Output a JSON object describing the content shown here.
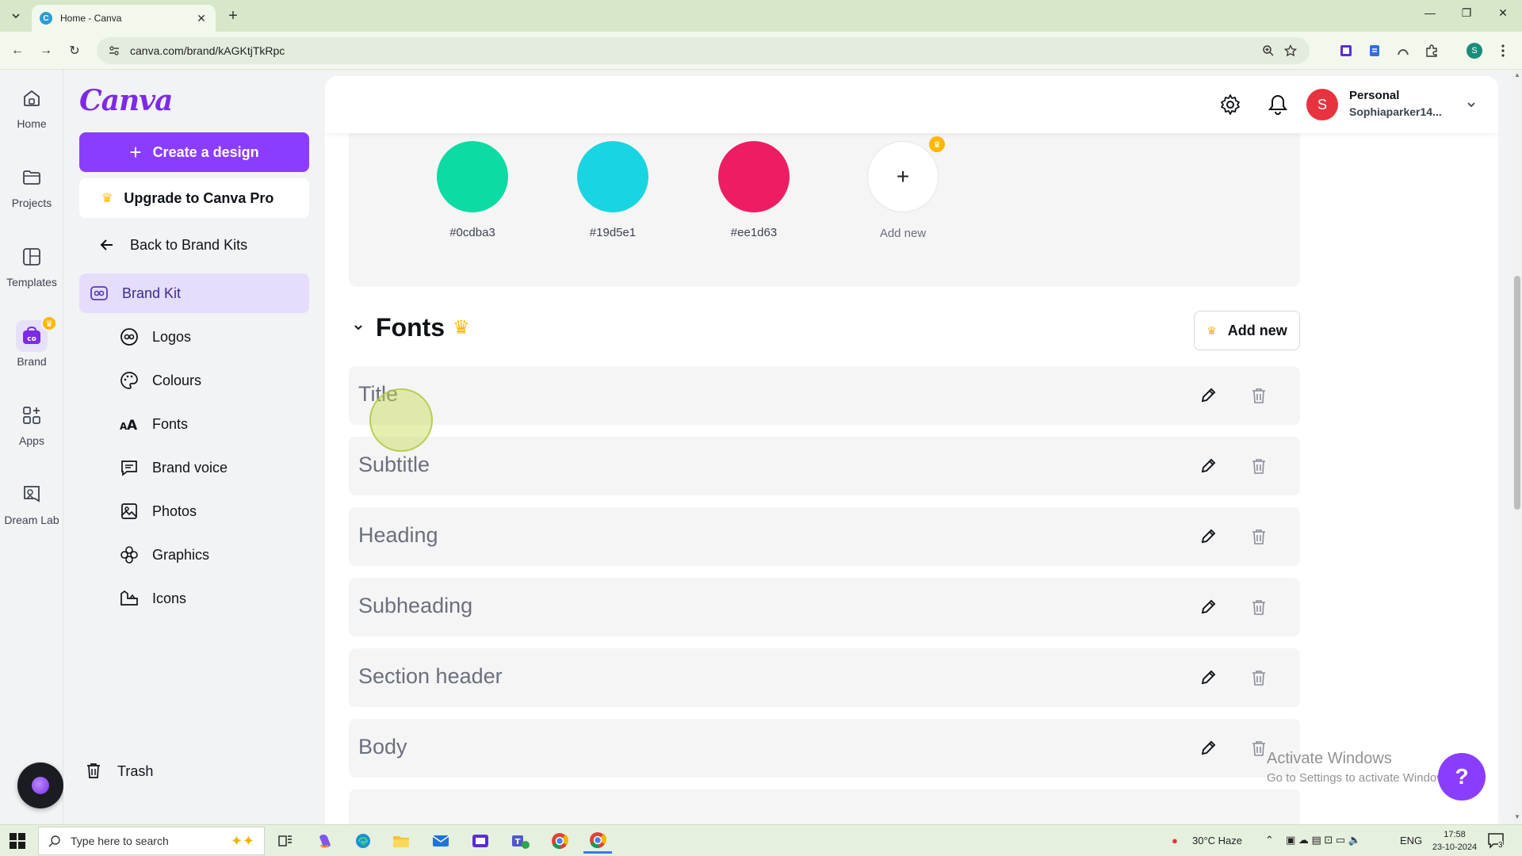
{
  "browser": {
    "tab_title": "Home - Canva",
    "url": "canva.com/brand/kAGKtjTkRpc",
    "profile_initial": "S"
  },
  "rail": {
    "items": [
      {
        "label": "Home"
      },
      {
        "label": "Projects"
      },
      {
        "label": "Templates"
      },
      {
        "label": "Brand"
      },
      {
        "label": "Apps"
      },
      {
        "label": "Dream Lab"
      }
    ]
  },
  "sidebar": {
    "logo": "Canva",
    "create_label": "Create a design",
    "upgrade_label": "Upgrade to Canva Pro",
    "back_label": "Back to Brand Kits",
    "brand_kit_label": "Brand Kit",
    "sub_items": [
      {
        "label": "Logos"
      },
      {
        "label": "Colours"
      },
      {
        "label": "Fonts"
      },
      {
        "label": "Brand voice"
      },
      {
        "label": "Photos"
      },
      {
        "label": "Graphics"
      },
      {
        "label": "Icons"
      }
    ],
    "trash_label": "Trash"
  },
  "header": {
    "avatar_initial": "S",
    "account_name": "Personal",
    "account_email": "Sophiaparker14..."
  },
  "colours": {
    "swatches": [
      {
        "hex": "#0cdba3",
        "label": "#0cdba3"
      },
      {
        "hex": "#19d5e1",
        "label": "#19d5e1"
      },
      {
        "hex": "#ee1d63",
        "label": "#ee1d63"
      }
    ],
    "add_new_label": "Add new"
  },
  "fonts": {
    "title": "Fonts",
    "add_new_label": "Add new",
    "rows": [
      {
        "label": "Title"
      },
      {
        "label": "Subtitle"
      },
      {
        "label": "Heading"
      },
      {
        "label": "Subheading"
      },
      {
        "label": "Section header"
      },
      {
        "label": "Body"
      }
    ]
  },
  "watermark": {
    "line1": "Activate Windows",
    "line2": "Go to Settings to activate Windows."
  },
  "help_label": "?",
  "taskbar": {
    "search_placeholder": "Type here to search",
    "weather": "30°C  Haze",
    "lang": "ENG",
    "time": "17:58",
    "date": "23-10-2024",
    "notif_count": "3"
  },
  "colors": {
    "brand_purple": "#8b3dff",
    "crown": "#ffb700",
    "avatar": "#e8323e"
  }
}
